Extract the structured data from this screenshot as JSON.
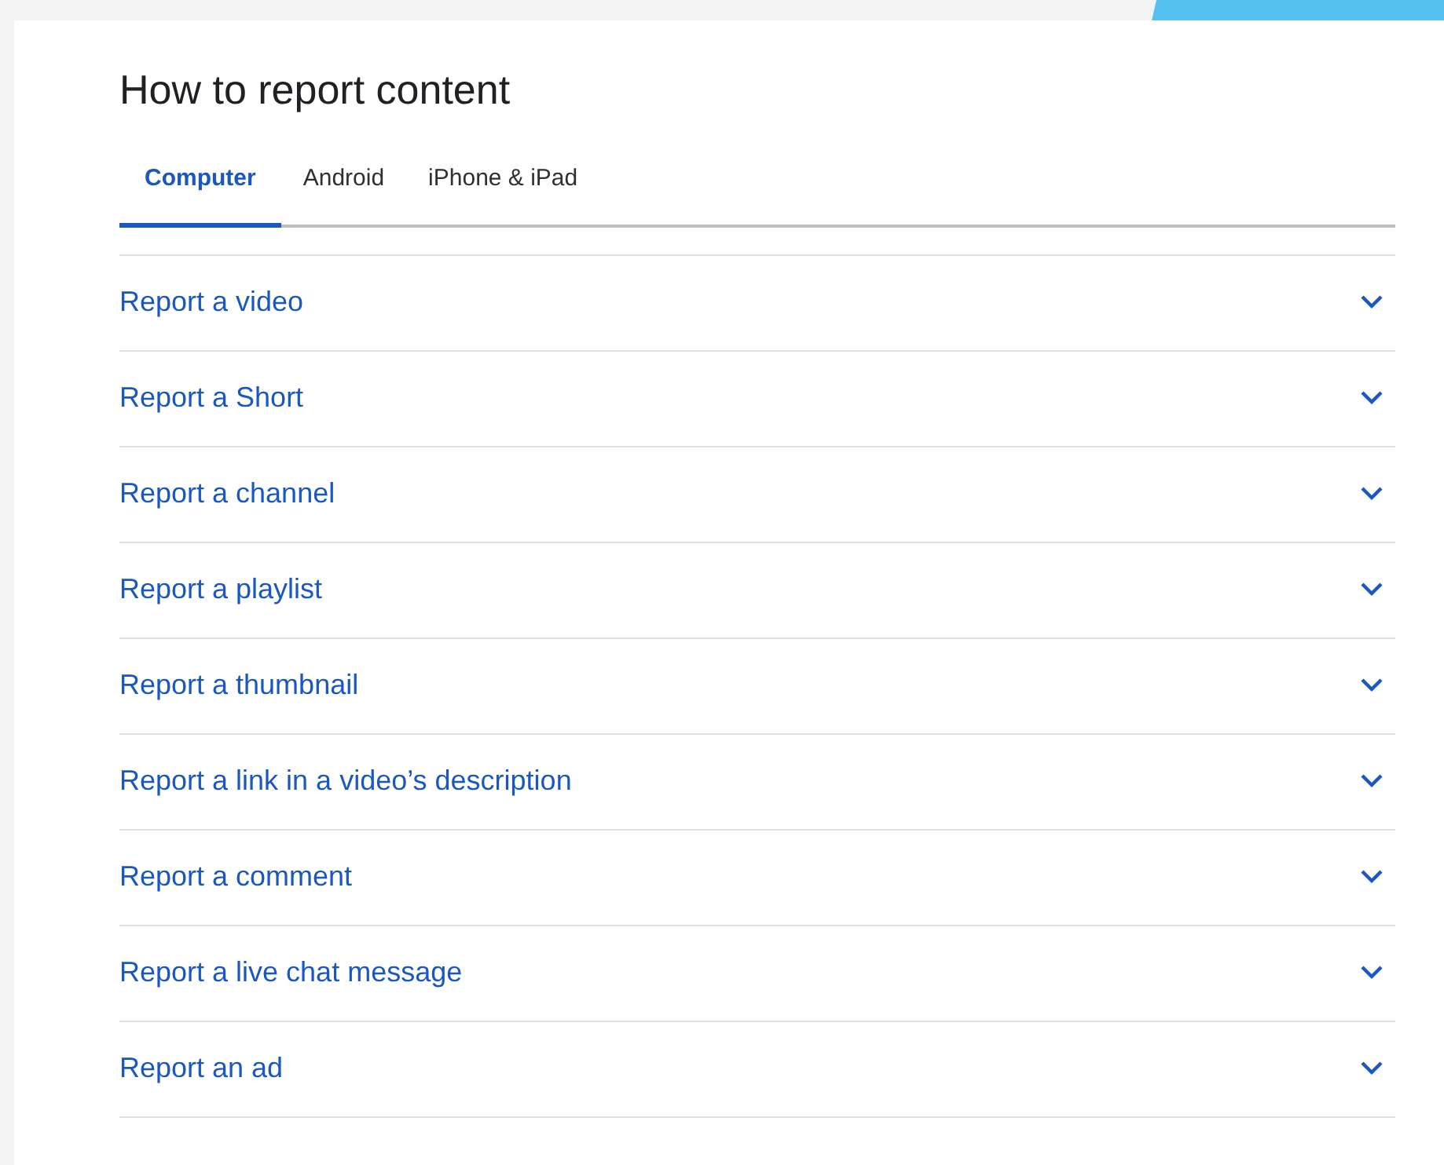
{
  "title": "How to report content",
  "tabs": [
    {
      "label": "Computer",
      "selected": true
    },
    {
      "label": "Android",
      "selected": false
    },
    {
      "label": "iPhone & iPad",
      "selected": false
    }
  ],
  "sections": [
    {
      "label": "Report a video",
      "expanded": false
    },
    {
      "label": "Report a Short",
      "expanded": false
    },
    {
      "label": "Report a channel",
      "expanded": false
    },
    {
      "label": "Report a playlist",
      "expanded": false
    },
    {
      "label": "Report a thumbnail",
      "expanded": false
    },
    {
      "label": "Report a link in a video’s description",
      "expanded": false
    },
    {
      "label": "Report a comment",
      "expanded": false
    },
    {
      "label": "Report a live chat message",
      "expanded": false
    },
    {
      "label": "Report an ad",
      "expanded": false
    }
  ]
}
